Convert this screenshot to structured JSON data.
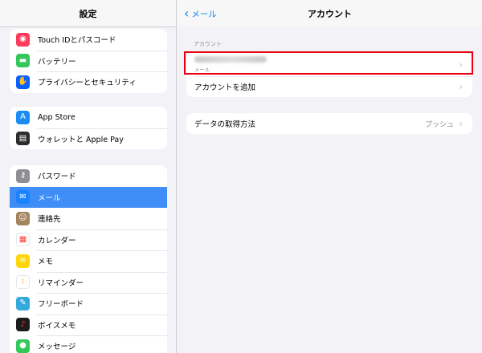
{
  "sidebar": {
    "title": "設定",
    "group1": [
      {
        "label": "Touch IDとパスコード",
        "icon": "fingerprint-icon",
        "color": "#ff3b5c",
        "glyph": "◉"
      },
      {
        "label": "バッテリー",
        "icon": "battery-icon",
        "color": "#34c759",
        "glyph": "▬"
      },
      {
        "label": "プライバシーとセキュリティ",
        "icon": "hand-icon",
        "color": "#0a60ff",
        "glyph": "✋"
      }
    ],
    "group2": [
      {
        "label": "App Store",
        "icon": "app-store-icon",
        "color": "#1c8cf5",
        "glyph": "A"
      },
      {
        "label": "ウォレットと Apple Pay",
        "icon": "wallet-icon",
        "color": "#2c2c2e",
        "glyph": "▤"
      }
    ],
    "group3": [
      {
        "label": "パスワード",
        "icon": "key-icon",
        "color": "#8e8e93",
        "glyph": "⚷"
      },
      {
        "label": "メール",
        "icon": "mail-icon",
        "color": "#1a82fb",
        "glyph": "✉",
        "selected": true
      },
      {
        "label": "連絡先",
        "icon": "contacts-icon",
        "color": "#a2845e",
        "glyph": "☺"
      },
      {
        "label": "カレンダー",
        "icon": "calendar-icon",
        "color": "#ffffff",
        "glyph": "▦",
        "fg": "#ff3b30"
      },
      {
        "label": "メモ",
        "icon": "notes-icon",
        "color": "#ffd60a",
        "glyph": "≡"
      },
      {
        "label": "リマインダー",
        "icon": "reminders-icon",
        "color": "#ffffff",
        "glyph": "⁝",
        "fg": "#ff9500"
      },
      {
        "label": "フリーボード",
        "icon": "freeform-icon",
        "color": "#34aadc",
        "glyph": "✎"
      },
      {
        "label": "ボイスメモ",
        "icon": "voice-memo-icon",
        "color": "#1c1c1e",
        "glyph": "♪",
        "fg": "#ff3b30"
      },
      {
        "label": "メッセージ",
        "icon": "messages-icon",
        "color": "#34c759",
        "glyph": "●"
      }
    ]
  },
  "navbar": {
    "back_label": "メール",
    "title": "アカウント"
  },
  "accounts": {
    "section_label": "アカウント",
    "account_sub": "メール",
    "add_account": "アカウントを追加"
  },
  "fetch": {
    "label": "データの取得方法",
    "value": "プッシュ"
  },
  "colors": {
    "accent": "#0a84ff",
    "selected_bg": "#3f8ef7",
    "highlight": "#e60012"
  }
}
